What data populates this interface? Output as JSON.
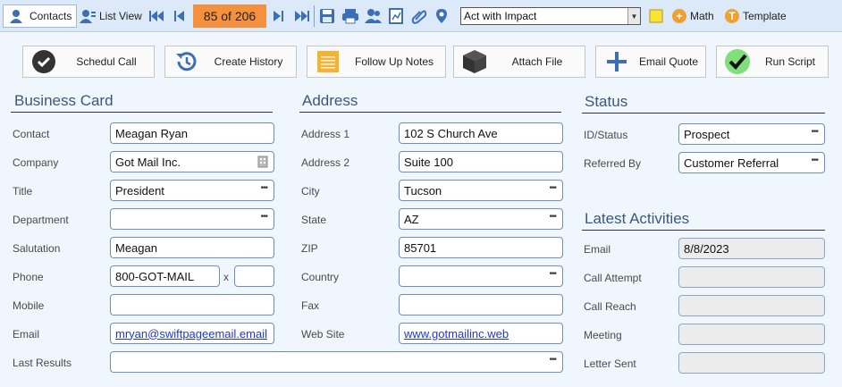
{
  "toolbar": {
    "contacts_label": "Contacts",
    "list_view_label": "List View",
    "record_counter": "85 of 206",
    "lookup_value": "Act with Impact",
    "math_label": "Math",
    "template_label": "Template"
  },
  "actions": [
    {
      "label": "Schedul Call"
    },
    {
      "label": "Create History"
    },
    {
      "label": "Follow Up Notes"
    },
    {
      "label": "Attach File"
    },
    {
      "label": "Email Quote"
    },
    {
      "label": "Run Script"
    }
  ],
  "business_card": {
    "title": "Business Card",
    "contact_label": "Contact",
    "contact_value": "Meagan Ryan",
    "company_label": "Company",
    "company_value": "Got Mail Inc.",
    "title_label": "Title",
    "title_value": "President",
    "department_label": "Department",
    "department_value": "",
    "salutation_label": "Salutation",
    "salutation_value": "Meagan",
    "phone_label": "Phone",
    "phone_value": "800-GOT-MAIL",
    "ext_label": "x",
    "ext_value": "",
    "mobile_label": "Mobile",
    "mobile_value": "",
    "email_label": "Email",
    "email_value": "mryan@swiftpageemail.email",
    "last_results_label": "Last Results",
    "last_results_value": ""
  },
  "address": {
    "title": "Address",
    "address1_label": "Address 1",
    "address1_value": "102 S Church Ave",
    "address2_label": "Address 2",
    "address2_value": "Suite 100",
    "city_label": "City",
    "city_value": "Tucson",
    "state_label": "State",
    "state_value": "AZ",
    "zip_label": "ZIP",
    "zip_value": "85701",
    "country_label": "Country",
    "country_value": "",
    "fax_label": "Fax",
    "fax_value": "",
    "website_label": "Web Site",
    "website_value": "www.gotmailinc.web"
  },
  "status": {
    "title": "Status",
    "id_status_label": "ID/Status",
    "id_status_value": "Prospect",
    "referred_by_label": "Referred By",
    "referred_by_value": "Customer Referral"
  },
  "latest_activities": {
    "title": "Latest Activities",
    "email_label": "Email",
    "email_value": "8/8/2023",
    "call_attempt_label": "Call Attempt",
    "call_attempt_value": "",
    "call_reach_label": "Call Reach",
    "call_reach_value": "",
    "meeting_label": "Meeting",
    "meeting_value": "",
    "letter_sent_label": "Letter Sent",
    "letter_sent_value": ""
  },
  "colors": {
    "accent": "#3b587c",
    "counter_bg": "#f5913d",
    "field_border": "#6a8fc2"
  }
}
